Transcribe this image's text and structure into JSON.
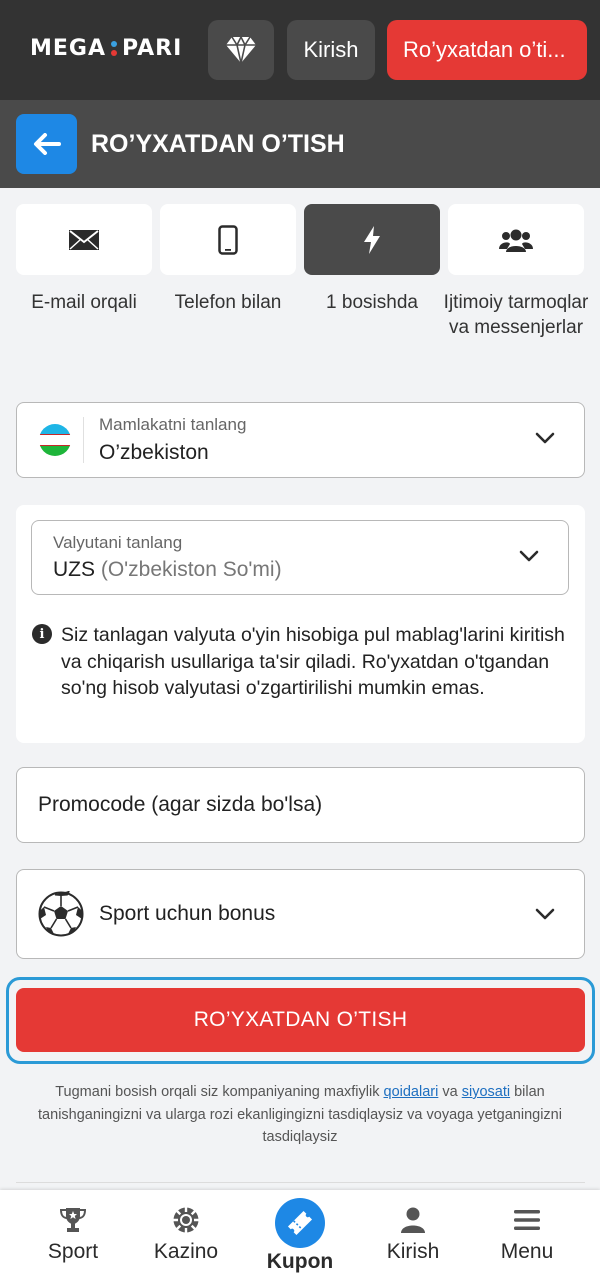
{
  "header": {
    "logo_left": "MEGA",
    "logo_right": "PARI",
    "diamond_icon": "diamond-icon",
    "login_label": "Kirish",
    "register_label": "Ro’yxatdan o’ti...",
    "colors": {
      "bar": "#333333",
      "register": "#e53935"
    }
  },
  "titlebar": {
    "back_icon": "arrow-left-icon",
    "title": "RO’YXATDAN O’TISH"
  },
  "methods": [
    {
      "icon": "envelope-icon",
      "label": "E-mail orqali",
      "active": false
    },
    {
      "icon": "phone-icon",
      "label": "Telefon bilan",
      "active": false
    },
    {
      "icon": "lightning-icon",
      "label": "1 bosishda",
      "active": true
    },
    {
      "icon": "users-icon",
      "label": "Ijtimoiy tarmoqlar va messenjerlar",
      "active": false
    }
  ],
  "country": {
    "label": "Mamlakatni tanlang",
    "value": "O’zbekiston",
    "flag_icon": "uzbekistan-flag-icon"
  },
  "currency": {
    "label": "Valyutani tanlang",
    "code": "UZS",
    "name": "(O'zbekiston So'mi)",
    "info": "Siz tanlagan valyuta o'yin hisobiga pul mablag'larini kiritish va chiqarish usullariga ta'sir qiladi. Ro'yxatdan o'tgandan so'ng hisob valyutasi o'zgartirilishi mumkin emas."
  },
  "promo": {
    "placeholder": "Promocode (agar sizda bo'lsa)"
  },
  "bonus": {
    "label": "Sport uchun bonus",
    "icon": "soccer-ball-icon"
  },
  "submit_label": "RO’YXATDAN O’TISH",
  "terms": {
    "before": "Tugmani bosish orqali siz kompaniyaning maxfiylik ",
    "link1": "qoidalari",
    "middle": " va ",
    "link2": "siyosati",
    "after": " bilan tanishganingizni va ularga rozi ekanligingizni tasdiqlaysiz va voyaga yetganingizni tasdiqlaysiz"
  },
  "bottom_nav": [
    {
      "label": "Sport",
      "icon": "trophy-icon"
    },
    {
      "label": "Kazino",
      "icon": "casino-chip-icon"
    },
    {
      "label": "Kupon",
      "icon": "ticket-icon",
      "active": true
    },
    {
      "label": "Kirish",
      "icon": "user-icon"
    },
    {
      "label": "Menu",
      "icon": "hamburger-icon"
    }
  ]
}
